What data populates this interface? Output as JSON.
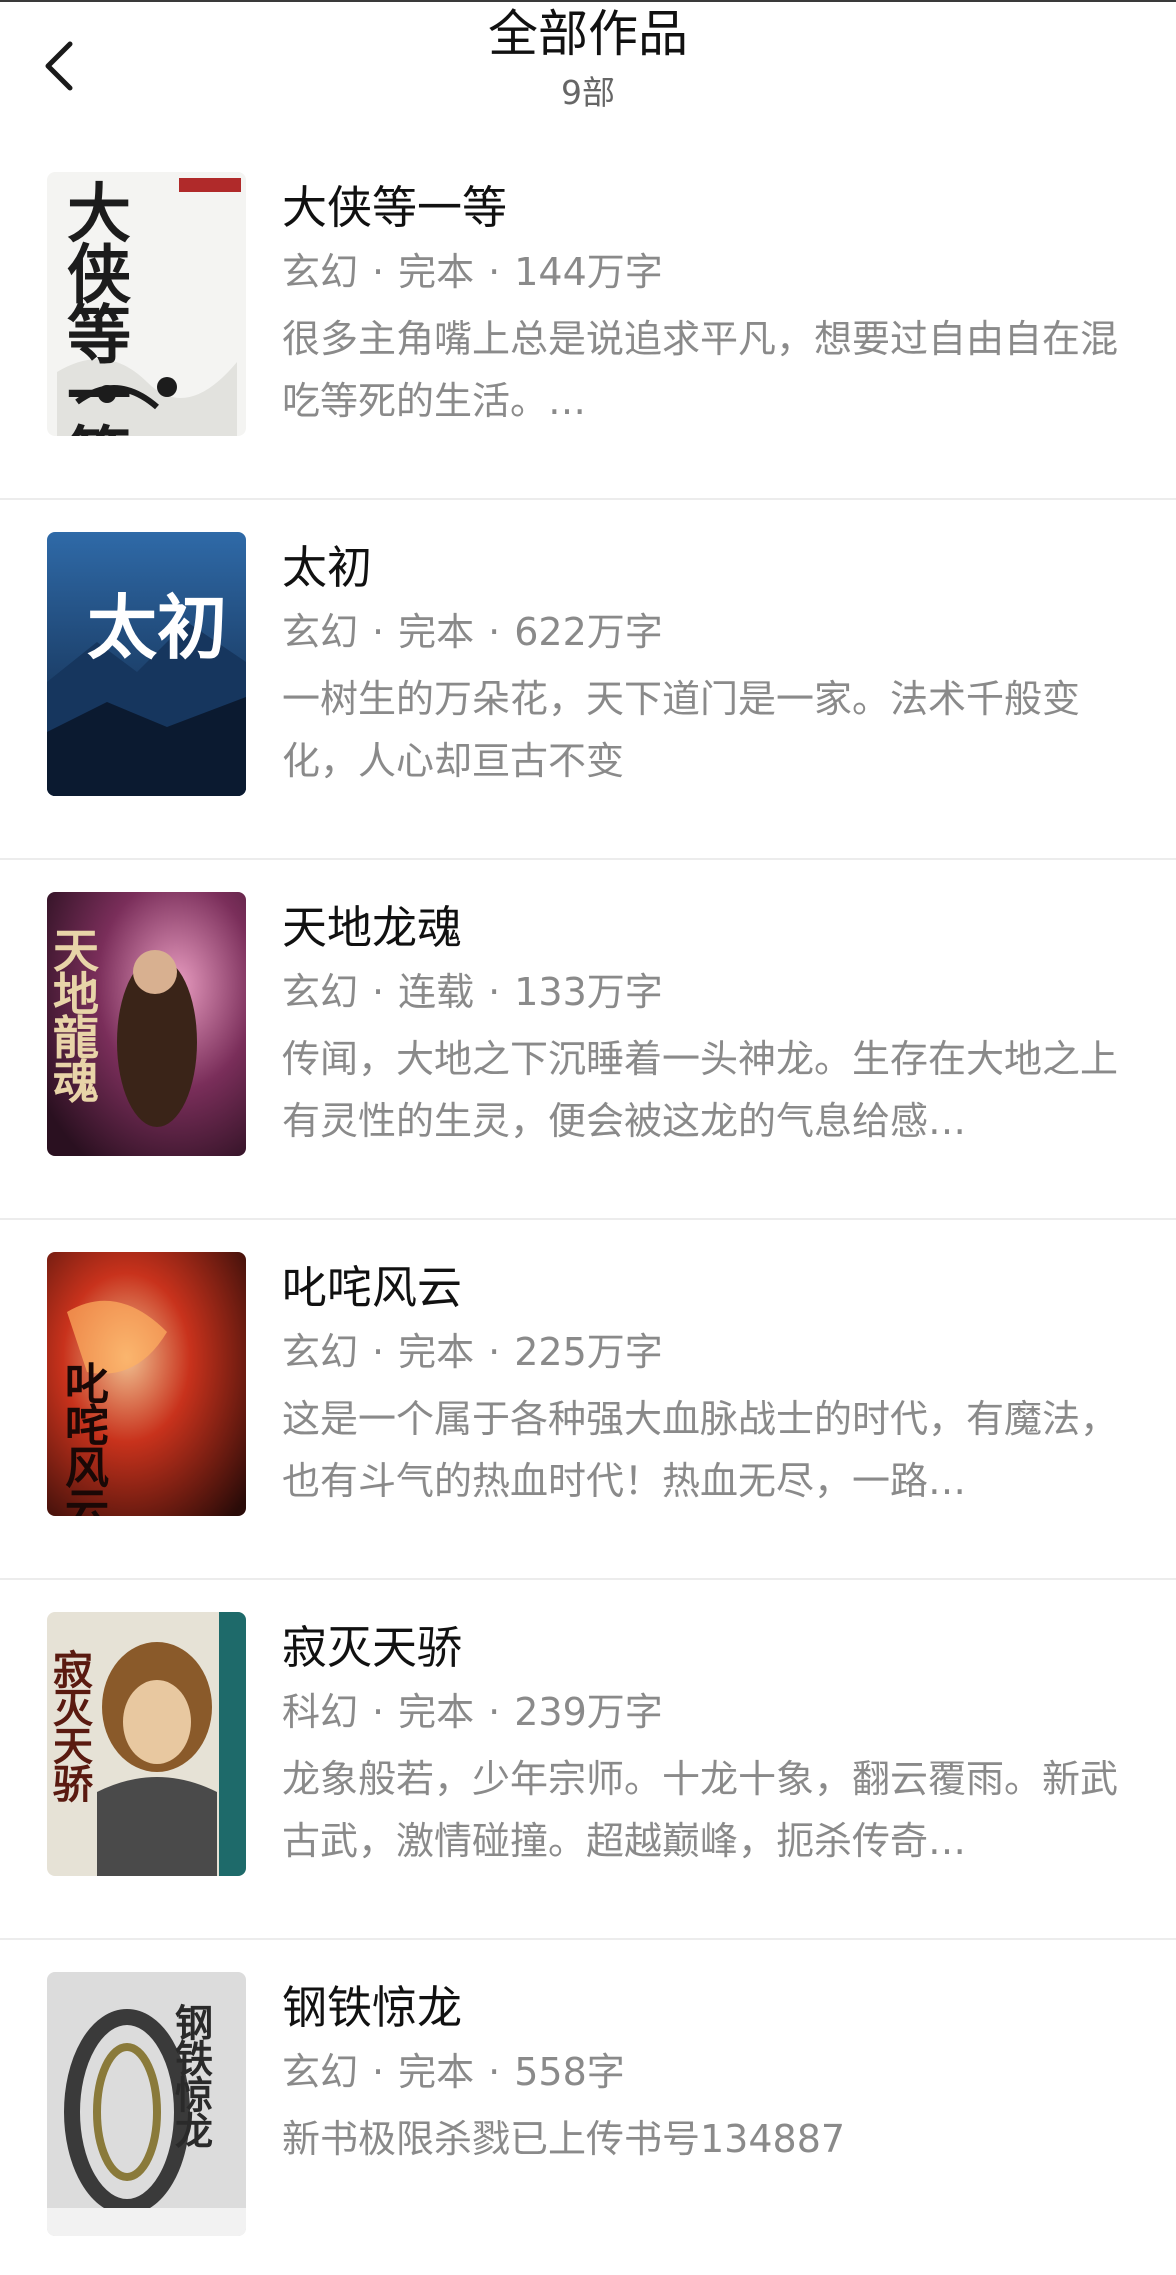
{
  "header": {
    "title": "全部作品",
    "count_label": "9部",
    "back_icon": "chevron-left-icon"
  },
  "books": [
    {
      "title": "大侠等一等",
      "genre": "玄幻",
      "status": "完本",
      "word_count": "144万字",
      "description": "很多主角嘴上总是说追求平凡，想要过自由自在混吃等死的生活。…",
      "cover_text": "大侠等一等",
      "cover_colors": [
        "#f4f4f2",
        "#1c1c1c",
        "#b02a2a"
      ]
    },
    {
      "title": "太初",
      "genre": "玄幻",
      "status": "完本",
      "word_count": "622万字",
      "description": "一树生的万朵花，天下道门是一家。法术千般变化，人心却亘古不变",
      "cover_text": "太初",
      "cover_colors": [
        "#1f4f86",
        "#0d1f3a",
        "#ffffff"
      ]
    },
    {
      "title": "天地龙魂",
      "genre": "玄幻",
      "status": "连载",
      "word_count": "133万字",
      "description": "传闻，大地之下沉睡着一头神龙。生存在大地之上有灵性的生灵，便会被这龙的气息给感…",
      "cover_text": "天地龍魂",
      "cover_colors": [
        "#3a1a2e",
        "#c4527a",
        "#e8d4a8"
      ]
    },
    {
      "title": "叱咤风云",
      "genre": "玄幻",
      "status": "完本",
      "word_count": "225万字",
      "description": "这是一个属于各种强大血脉战士的时代，有魔法，也有斗气的热血时代！热血无尽，一路…",
      "cover_text": "叱咤风云",
      "cover_colors": [
        "#2a0b08",
        "#c8321c",
        "#f0c090"
      ]
    },
    {
      "title": "寂灭天骄",
      "genre": "科幻",
      "status": "完本",
      "word_count": "239万字",
      "description": "龙象般若，少年宗师。十龙十象，翻云覆雨。新武古武，激情碰撞。超越巅峰，扼杀传奇…",
      "cover_text": "寂灭天骄",
      "cover_colors": [
        "#e6e2d6",
        "#6a4a2a",
        "#1e6a6a"
      ]
    },
    {
      "title": "钢铁惊龙",
      "genre": "玄幻",
      "status": "完本",
      "word_count": "558字",
      "description": "新书极限杀戮已上传书号134887",
      "cover_text": "钢铁惊龙",
      "cover_colors": [
        "#dcdcdc",
        "#3a3a3a",
        "#c03020"
      ]
    }
  ]
}
